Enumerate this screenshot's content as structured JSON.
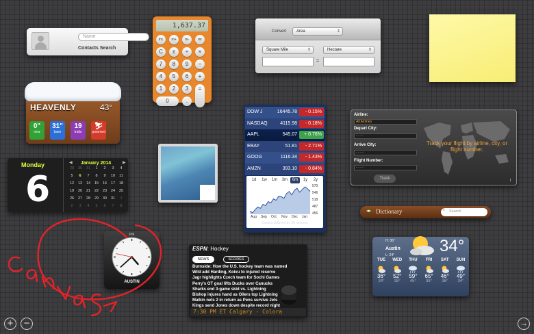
{
  "contacts": {
    "name_placeholder": "Name",
    "title": "Contacts Search"
  },
  "calculator": {
    "display": "1,637.37",
    "keys": [
      "mc",
      "m+",
      "m-",
      "mr",
      "C",
      "±",
      "÷",
      "×",
      "7",
      "8",
      "9",
      "−",
      "4",
      "5",
      "6",
      "+",
      "1",
      "2",
      "3",
      "=",
      "0",
      "."
    ]
  },
  "converter": {
    "label": "Convert",
    "category": "Area",
    "from_unit": "Square Mile",
    "to_unit": "Hectare",
    "equals": "="
  },
  "ski": {
    "resort": "HEAVENLY",
    "temp": "43°",
    "tiles": [
      {
        "value": "0\"",
        "label": "new",
        "color": "#31a336"
      },
      {
        "value": "31\"",
        "label": "base",
        "color": "#2c6fd6"
      },
      {
        "value": "19",
        "label": "trails",
        "color": "#8c3db3"
      },
      {
        "value": "",
        "label": "groomed",
        "color": "#d43b2b"
      }
    ]
  },
  "stocks": {
    "rows": [
      {
        "symbol": "DOW J",
        "price": "16445.78",
        "change": "- 0.15%",
        "up": false
      },
      {
        "symbol": "NASDAQ",
        "price": "4115.98",
        "change": "- 0.18%",
        "up": false
      },
      {
        "symbol": "AAPL",
        "price": "545.07",
        "change": "+ 0.76%",
        "up": true
      },
      {
        "symbol": "EBAY",
        "price": "51.81",
        "change": "- 2.71%",
        "up": false
      },
      {
        "symbol": "GOOG",
        "price": "1116.34",
        "change": "- 1.43%",
        "up": false
      },
      {
        "symbol": "AMZN",
        "price": "393.10",
        "change": "- 0.84%",
        "up": false
      }
    ],
    "ranges": [
      "1d",
      "1w",
      "1m",
      "3m",
      "6m",
      "1y",
      "2y"
    ],
    "active_range": "6m",
    "y_ticks": [
      "570",
      "546",
      "518",
      "487",
      "456"
    ],
    "x_ticks": [
      "Aug",
      "Sep",
      "Oct",
      "Nov",
      "Dec",
      "Jan"
    ],
    "footnote": "Quotes delayed by 20 minutes",
    "chart_series": [
      475,
      468,
      480,
      490,
      485,
      500,
      495,
      510,
      505,
      520,
      515,
      530,
      528,
      522,
      540,
      548,
      535,
      552,
      560,
      545,
      555,
      565,
      558,
      548
    ]
  },
  "flight": {
    "airline_label": "Airline:",
    "airline_value": "All Airlines",
    "depart_label": "Depart City:",
    "depart_value": "- - - -",
    "arrive_label": "Arrive City:",
    "arrive_value": "- - - -",
    "number_label": "Flight Number:",
    "number_value": "- - - -",
    "message": "Track your flight by airline, city, or flight number.",
    "track_label": "Track"
  },
  "calendar": {
    "weekday": "Monday",
    "day": "6",
    "month": "January 2014",
    "weeks": [
      [
        "29",
        "30",
        "31",
        "1",
        "2",
        "3",
        "4"
      ],
      [
        "5",
        "6",
        "7",
        "8",
        "9",
        "10",
        "11"
      ],
      [
        "12",
        "13",
        "14",
        "15",
        "16",
        "17",
        "18"
      ],
      [
        "19",
        "20",
        "21",
        "22",
        "23",
        "24",
        "25"
      ],
      [
        "26",
        "27",
        "28",
        "29",
        "30",
        "31",
        "1"
      ],
      [
        "2",
        "3",
        "4",
        "5",
        "6",
        "7",
        "8"
      ]
    ]
  },
  "dictionary": {
    "title": "Dictionary",
    "search_placeholder": "Search"
  },
  "clock": {
    "ampm": "PM",
    "city": "AUSTIN",
    "hour": 4,
    "minute": 38,
    "second": 47
  },
  "espn": {
    "logo": "ESPN",
    "sport": "Hockey",
    "tab_news": "NEWS",
    "tab_scores": "SCORES",
    "headlines": [
      "Burnside: How the U.S. hockey team was named",
      "Wild add Harding, Koivu to injured reserve",
      "Jagr highlights Czech team for Sochi Games",
      "Perry's OT goal lifts Ducks over Canucks",
      "Sharks end 3-game skid vs. Lightning",
      "Bishop injures hand as Oilers top Lightning",
      "Malkin nets 2 in return as Pens survive Jets",
      "Kings send Jones down despite record night"
    ],
    "ticker": "7:30 PM ET   Calgary - Colora"
  },
  "weather": {
    "high": "H: 36°",
    "low": "L: 24°",
    "city": "Austin",
    "temp": "34°",
    "days": [
      {
        "day": "TUE",
        "hi": "36°",
        "lo": "24°",
        "icon": "sun-cloud-icon"
      },
      {
        "day": "WED",
        "hi": "52°",
        "lo": "38°",
        "icon": "sun-cloud-icon"
      },
      {
        "day": "THU",
        "hi": "59°",
        "lo": "45°",
        "icon": "rain-icon"
      },
      {
        "day": "FRI",
        "hi": "65°",
        "lo": "38°",
        "icon": "sun-cloud-icon"
      },
      {
        "day": "SAT",
        "hi": "46°",
        "lo": "36°",
        "icon": "sun-cloud-icon"
      },
      {
        "day": "SUN",
        "hi": "49°",
        "lo": "34°",
        "icon": "rain-icon"
      }
    ]
  },
  "controls": {
    "add": "+",
    "remove": "−",
    "next": "→"
  }
}
